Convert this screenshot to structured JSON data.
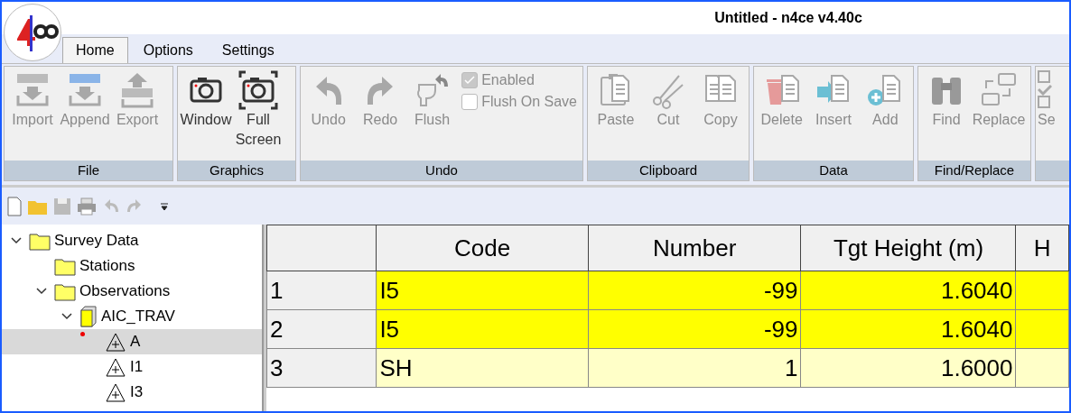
{
  "window": {
    "title": "Untitled - n4ce v4.40c"
  },
  "tabs": [
    {
      "label": "Home",
      "selected": true
    },
    {
      "label": "Options",
      "selected": false
    },
    {
      "label": "Settings",
      "selected": false
    }
  ],
  "ribbon": {
    "groups": [
      {
        "label": "File",
        "items": [
          {
            "kind": "button",
            "label": "Import",
            "disabled": true
          },
          {
            "kind": "button",
            "label": "Append",
            "disabled": true
          },
          {
            "kind": "button",
            "label": "Export",
            "disabled": true
          }
        ]
      },
      {
        "label": "Graphics",
        "items": [
          {
            "kind": "button",
            "label": "Window",
            "disabled": false
          },
          {
            "kind": "button",
            "label": "Full Screen",
            "disabled": false
          }
        ]
      },
      {
        "label": "Undo",
        "items": [
          {
            "kind": "button",
            "label": "Undo",
            "disabled": true
          },
          {
            "kind": "button",
            "label": "Redo",
            "disabled": true
          },
          {
            "kind": "button",
            "label": "Flush",
            "disabled": true
          },
          {
            "kind": "checks",
            "options": [
              {
                "label": "Enabled",
                "checked": true
              },
              {
                "label": "Flush On Save",
                "checked": false
              }
            ]
          }
        ]
      },
      {
        "label": "Clipboard",
        "items": [
          {
            "kind": "button",
            "label": "Paste",
            "disabled": true
          },
          {
            "kind": "button",
            "label": "Cut",
            "disabled": true
          },
          {
            "kind": "button",
            "label": "Copy",
            "disabled": true
          }
        ]
      },
      {
        "label": "Data",
        "items": [
          {
            "kind": "button",
            "label": "Delete",
            "disabled": true
          },
          {
            "kind": "button",
            "label": "Insert",
            "disabled": true
          },
          {
            "kind": "button",
            "label": "Add",
            "disabled": true
          }
        ]
      },
      {
        "label": "Find/Replace",
        "items": [
          {
            "kind": "button",
            "label": "Find",
            "disabled": true
          },
          {
            "kind": "button",
            "label": "Replace",
            "disabled": true
          }
        ]
      },
      {
        "items": [
          {
            "kind": "button",
            "label": "Se",
            "disabled": true
          }
        ]
      }
    ]
  },
  "tree": [
    {
      "label": "Survey Data",
      "kind": "folder",
      "expanded": true,
      "selected": false,
      "children": [
        {
          "label": "Stations",
          "kind": "folder",
          "selected": false
        },
        {
          "label": "Observations",
          "kind": "folder",
          "expanded": true,
          "selected": false,
          "children": [
            {
              "label": "AIC_TRAV",
              "kind": "file",
              "expanded": true,
              "selected": false,
              "children": [
                {
                  "label": "A",
                  "kind": "station",
                  "selected": true,
                  "flagged": true
                },
                {
                  "label": "I1",
                  "kind": "station",
                  "selected": false,
                  "flagged": false
                },
                {
                  "label": "I3",
                  "kind": "station",
                  "selected": false,
                  "flagged": false
                }
              ]
            }
          ]
        }
      ]
    }
  ],
  "table": {
    "columns": [
      "",
      "Code",
      "Number",
      "Tgt Height (m)",
      "H"
    ],
    "rows": [
      {
        "cells": [
          "1",
          "I5",
          "-99",
          "1.6040",
          ""
        ],
        "highlighted": true
      },
      {
        "cells": [
          "2",
          "I5",
          "-99",
          "1.6040",
          ""
        ],
        "highlighted": true
      },
      {
        "cells": [
          "3",
          "SH",
          "1",
          "1.6000",
          ""
        ],
        "highlighted": false
      }
    ]
  }
}
